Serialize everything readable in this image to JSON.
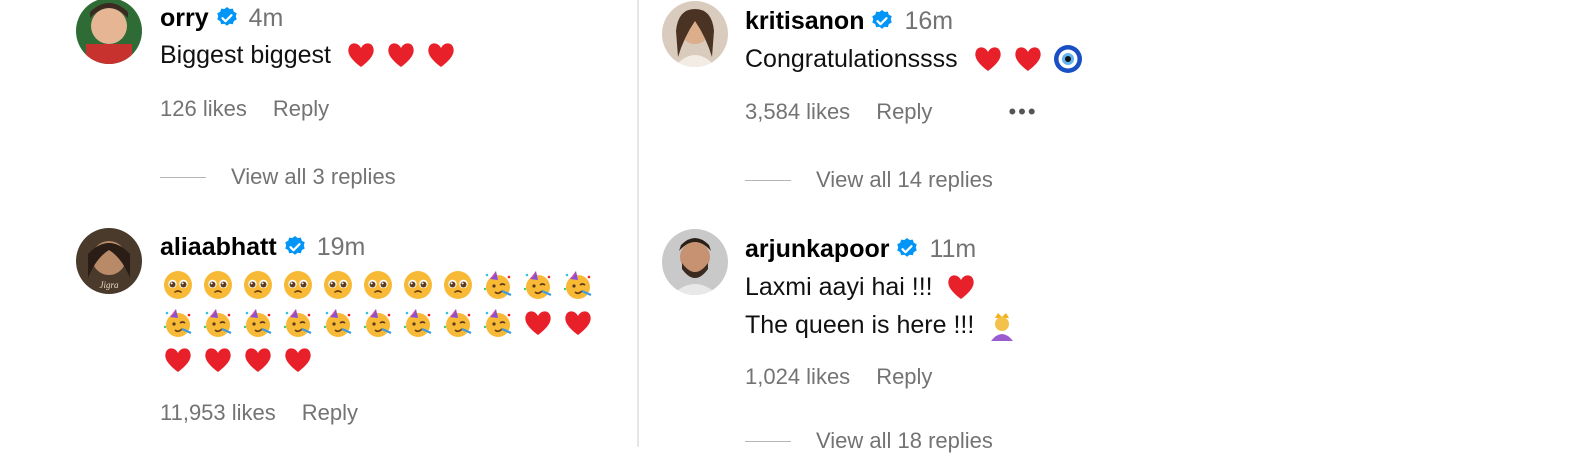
{
  "left": {
    "orry": {
      "username": "orry",
      "time": "4m",
      "text": "Biggest biggest",
      "likes": "126 likes",
      "reply": "Reply",
      "view_replies": "View all 3 replies"
    },
    "alia": {
      "username": "aliaabhatt",
      "time": "19m",
      "likes": "11,953 likes",
      "reply": "Reply",
      "emoji_rows": [
        [
          "pleading-face",
          "pleading-face",
          "pleading-face",
          "pleading-face",
          "pleading-face",
          "pleading-face",
          "pleading-face",
          "pleading-face",
          "partying-face",
          "partying-face",
          "partying-face"
        ],
        [
          "partying-face",
          "partying-face",
          "partying-face",
          "partying-face",
          "partying-face",
          "partying-face",
          "partying-face",
          "partying-face",
          "partying-face",
          "red-heart",
          "red-heart"
        ],
        [
          "red-heart",
          "red-heart",
          "red-heart",
          "red-heart"
        ]
      ]
    }
  },
  "right": {
    "kriti": {
      "username": "kritisanon",
      "time": "16m",
      "text": "Congratulationssss",
      "likes": "3,584 likes",
      "reply": "Reply",
      "more": "•••",
      "view_replies": "View all 14 replies"
    },
    "arjun": {
      "username": "arjunkapoor",
      "time": "11m",
      "line1": "Laxmi aayi hai !!!",
      "line2": "The queen is here !!!",
      "likes": "1,024 likes",
      "reply": "Reply",
      "view_replies_partial": "View all 18 replies"
    }
  },
  "colors": {
    "verified": "#0095f6",
    "muted": "#737373",
    "heart": "#e8202a"
  }
}
